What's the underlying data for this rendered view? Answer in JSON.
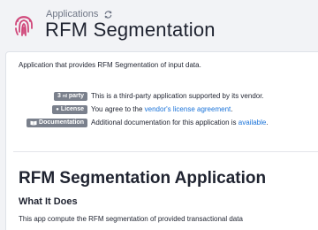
{
  "header": {
    "breadcrumb": "Applications",
    "title": "RFM Segmentation",
    "logo_color": "#d0477a"
  },
  "panel": {
    "description": "Application that provides RFM Segmentation of input data.",
    "rows": [
      {
        "badge": "3",
        "badge_sup": "rd",
        "badge_suffix": " party",
        "text_before": "This is a third-party application supported by its vendor.",
        "link": "",
        "text_after": ""
      },
      {
        "badge_icon": "⬤",
        "badge": "License",
        "text_before": "You agree to the ",
        "link": "vendor's license agreement",
        "text_after": "."
      },
      {
        "badge_icon": "📖",
        "badge": "Documentation",
        "text_before": "Additional documentation for this application is ",
        "link": "available",
        "text_after": "."
      }
    ],
    "app_title": "RFM Segmentation Application",
    "section_heading": "What It Does",
    "section_text": "This app compute the RFM segmentation of provided transactional data"
  },
  "colors": {
    "accent": "#1a73d9",
    "badge": "#7a808c",
    "background": "#f2f3f6"
  }
}
